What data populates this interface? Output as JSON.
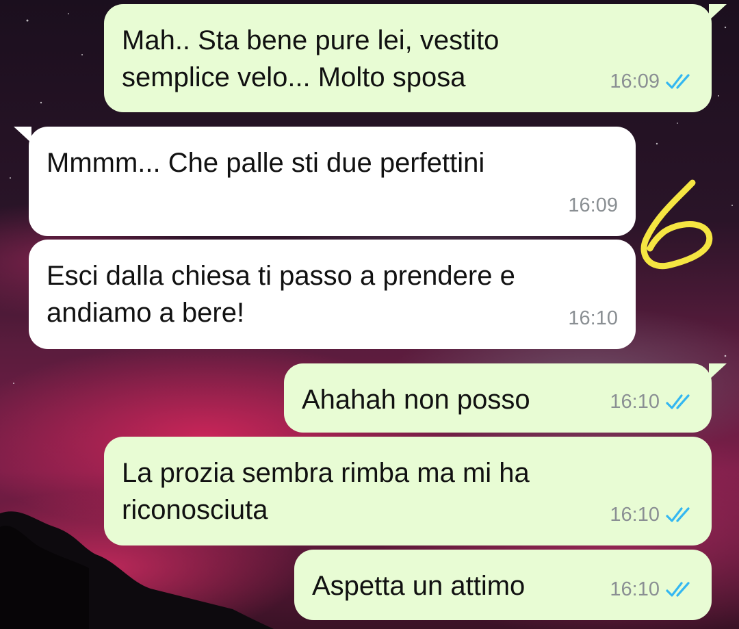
{
  "colors": {
    "outgoing_bubble": "#e8fcd4",
    "incoming_bubble": "#ffffff",
    "timestamp": "#8a8f93",
    "read_ticks": "#34b7f1",
    "annotation": "#f5e642"
  },
  "annotation": {
    "label": "6",
    "type": "handwritten-number"
  },
  "messages": [
    {
      "direction": "out",
      "text": "Mah.. Sta bene pure lei, vestito\nsemplice velo... Molto sposa",
      "time": "16:09",
      "status": "read"
    },
    {
      "direction": "in",
      "text": "Mmmm... Che palle sti due perfettini",
      "time": "16:09"
    },
    {
      "direction": "in",
      "text": "Esci dalla chiesa ti passo a prendere e\nandiamo a bere!",
      "time": "16:10"
    },
    {
      "direction": "out",
      "text": "Ahahah non posso",
      "time": "16:10",
      "status": "read"
    },
    {
      "direction": "out",
      "text": "La prozia sembra rimba ma mi ha\nriconosciuta",
      "time": "16:10",
      "status": "read"
    },
    {
      "direction": "out",
      "text": "Aspetta un attimo",
      "time": "16:10",
      "status": "read"
    }
  ]
}
